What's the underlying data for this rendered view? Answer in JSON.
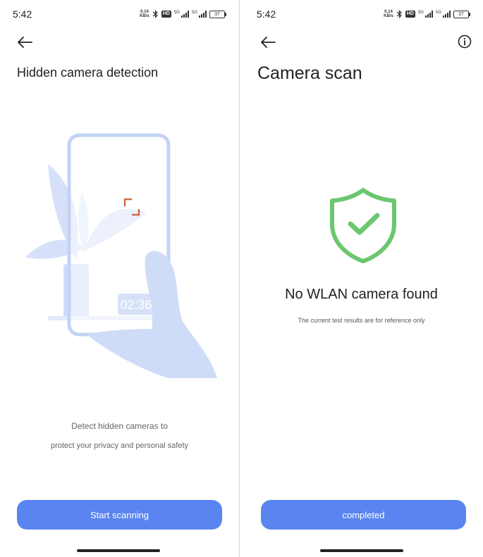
{
  "left": {
    "status": {
      "time": "5:42",
      "net_speed_value": "0.14",
      "net_speed_unit": "KB/s",
      "hd": "HD",
      "signal1": "5G",
      "signal2": "5G",
      "battery": "37"
    },
    "title": "Hidden camera detection",
    "illustration": {
      "timer": "02:36"
    },
    "description_line1": "Detect hidden cameras to",
    "description_line2": "protect your privacy and personal safety",
    "button_label": "Start scanning"
  },
  "right": {
    "status": {
      "time": "5:42",
      "net_speed_value": "0.14",
      "net_speed_unit": "KB/s",
      "hd": "HD",
      "signal1": "5G",
      "signal2": "5G",
      "battery": "37"
    },
    "title": "Camera scan",
    "result_title": "No WLAN camera found",
    "result_note": "The current test results are for reference only",
    "button_label": "completed"
  },
  "colors": {
    "accent": "#5a85f0",
    "success": "#6cc66f",
    "illustration": "#cfdcf8",
    "viewfinder": "#d06a4f"
  }
}
